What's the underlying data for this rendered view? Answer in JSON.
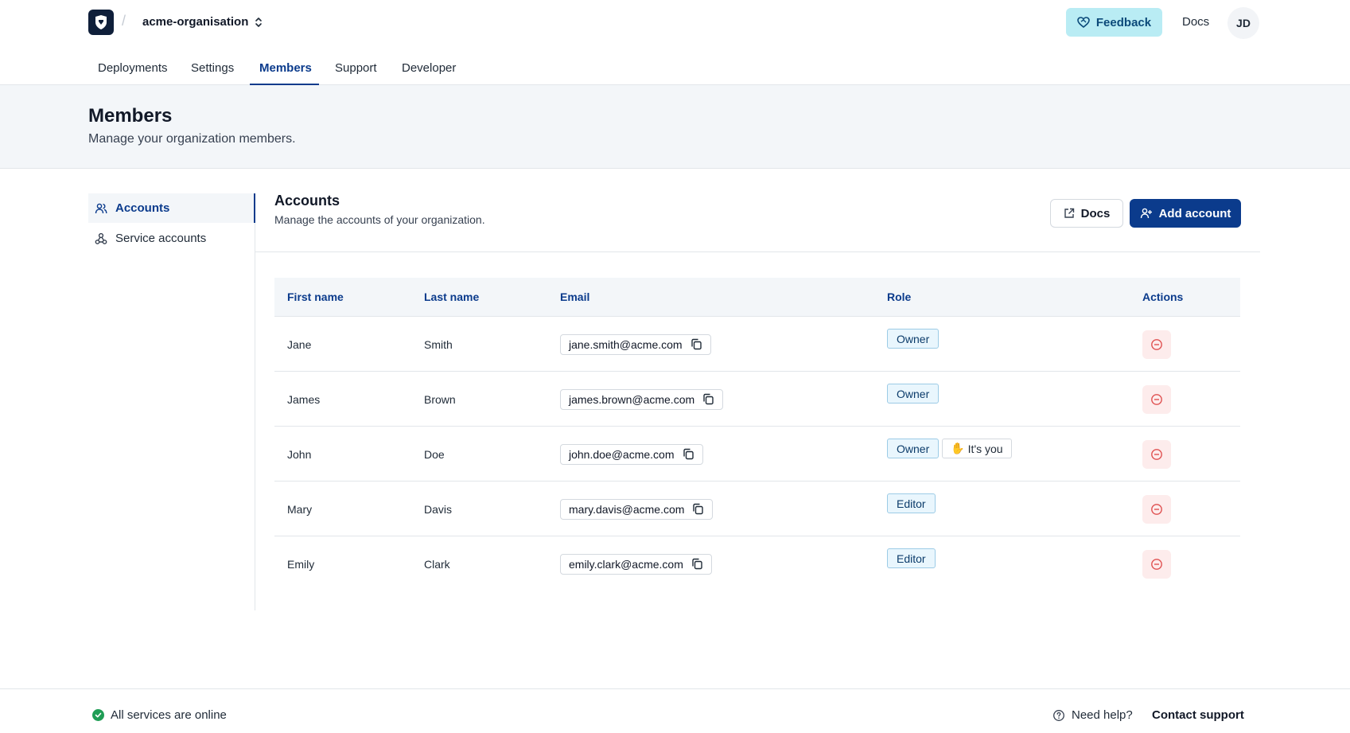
{
  "header": {
    "org_name": "acme-organisation",
    "separator": "/",
    "feedback_label": "Feedback",
    "docs_label": "Docs",
    "avatar_initials": "JD"
  },
  "nav": {
    "tabs": [
      {
        "label": "Deployments",
        "active": false
      },
      {
        "label": "Settings",
        "active": false
      },
      {
        "label": "Members",
        "active": true
      },
      {
        "label": "Support",
        "active": false
      },
      {
        "label": "Developer",
        "active": false
      }
    ]
  },
  "page": {
    "title": "Members",
    "subtitle": "Manage your organization members."
  },
  "sidebar": {
    "items": [
      {
        "label": "Accounts",
        "icon": "users-icon",
        "active": true
      },
      {
        "label": "Service accounts",
        "icon": "webhook-icon",
        "active": false
      }
    ]
  },
  "section": {
    "title": "Accounts",
    "subtitle": "Manage the accounts of your organization.",
    "docs_button": "Docs",
    "add_button": "Add account"
  },
  "table": {
    "columns": [
      "First name",
      "Last name",
      "Email",
      "Role",
      "Actions"
    ],
    "rows": [
      {
        "first": "Jane",
        "last": "Smith",
        "email": "jane.smith@acme.com",
        "role": "Owner",
        "you": ""
      },
      {
        "first": "James",
        "last": "Brown",
        "email": "james.brown@acme.com",
        "role": "Owner",
        "you": ""
      },
      {
        "first": "John",
        "last": "Doe",
        "email": "john.doe@acme.com",
        "role": "Owner",
        "you": "It's you"
      },
      {
        "first": "Mary",
        "last": "Davis",
        "email": "mary.davis@acme.com",
        "role": "Editor",
        "you": ""
      },
      {
        "first": "Emily",
        "last": "Clark",
        "email": "emily.clark@acme.com",
        "role": "Editor",
        "you": ""
      }
    ]
  },
  "footer": {
    "status": "All services are online",
    "need_help": "Need help?",
    "contact": "Contact support"
  },
  "colors": {
    "primary": "#0b3b8c",
    "feedback_bg": "#b9ecf4",
    "status_online": "#1f9d55",
    "danger": "#e05252",
    "danger_bg": "#fdecec",
    "role_badge_bg": "#e9f6fd"
  }
}
